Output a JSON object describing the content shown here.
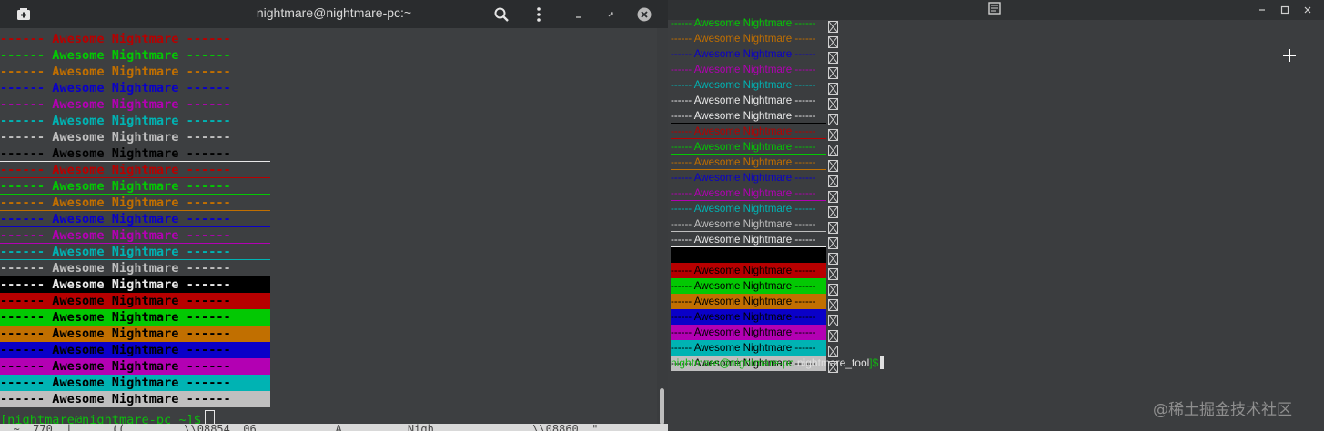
{
  "left_window": {
    "title": "nightmare@nightmare-pc:~",
    "icons": {
      "new_tab": "new-tab-icon",
      "search": "search-icon",
      "menu": "kebab-menu-icon",
      "minimize": "minimize-icon",
      "maximize": "maximize-icon",
      "close": "close-icon"
    },
    "line_text": [
      "------ ",
      "Awesome",
      " ",
      "Nightmare",
      " ------"
    ],
    "prompt": {
      "text": "[nightmare@nightmare-pc ~]$",
      "color": "#0bbf0b"
    },
    "bottom_strip_text": "  ~  770  |  ..  ((  ..    .\\\\08854  06            A          Nigh               \\\\08860  \""
  },
  "right_window": {
    "icons": {
      "app": "terminal-app-icon",
      "minimize": "minimize-icon",
      "maximize": "maximize-icon",
      "close": "close-icon"
    },
    "line_text": "------ Awesome Nightmare ------",
    "prompt": {
      "user_host": "nightmare@nightmare-pc",
      "dir": " nightmare_tool",
      "suffix": "]$"
    }
  },
  "colors": {
    "black": "#000000",
    "red": "#b70000",
    "green": "#03c803",
    "yellow": "#c16f00",
    "blue": "#0a00c8",
    "magenta": "#b300b3",
    "cyan": "#00b3b3",
    "white": "#bfbfbf",
    "text_default": "#e8e8e8"
  },
  "watermark": "@稀土掘金技术社区"
}
